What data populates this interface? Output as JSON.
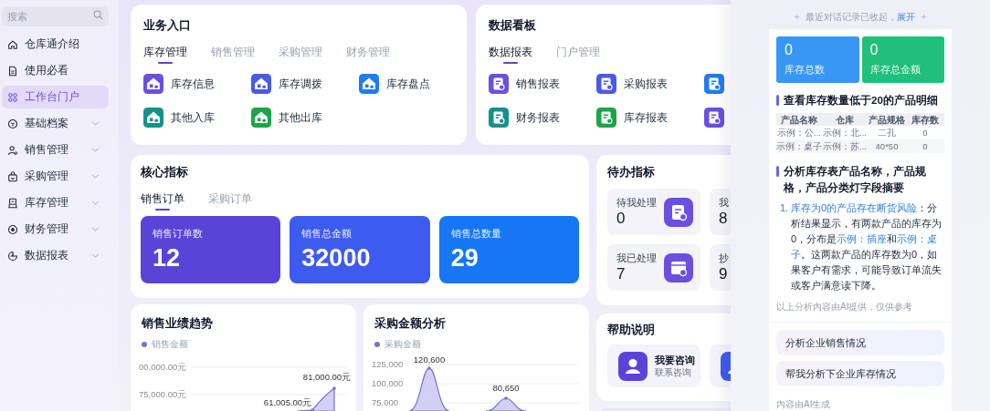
{
  "sidebar": {
    "search": {
      "placeholder": "搜索"
    },
    "items": [
      {
        "label": "仓库通介绍",
        "selected": false,
        "expandable": false
      },
      {
        "label": "使用必看",
        "selected": false,
        "expandable": false
      },
      {
        "label": "工作台门户",
        "selected": true,
        "expandable": false
      },
      {
        "label": "基础档案",
        "selected": false,
        "expandable": true
      },
      {
        "label": "销售管理",
        "selected": false,
        "expandable": true
      },
      {
        "label": "采购管理",
        "selected": false,
        "expandable": true
      },
      {
        "label": "库存管理",
        "selected": false,
        "expandable": true
      },
      {
        "label": "财务管理",
        "selected": false,
        "expandable": true
      },
      {
        "label": "数据报表",
        "selected": false,
        "expandable": true
      }
    ]
  },
  "entry_card": {
    "title": "业务入口",
    "tabs": [
      {
        "label": "库存管理",
        "selected": true
      },
      {
        "label": "销售管理",
        "selected": false
      },
      {
        "label": "采购管理",
        "selected": false
      },
      {
        "label": "财务管理",
        "selected": false
      }
    ],
    "items": [
      {
        "label": "库存信息",
        "color": "#6a4fe0"
      },
      {
        "label": "库存调拨",
        "color": "#4a5ae8"
      },
      {
        "label": "库存盘点",
        "color": "#1f7cf2"
      },
      {
        "label": "其他入库",
        "color": "#16918a"
      },
      {
        "label": "其他出库",
        "color": "#1ca548"
      }
    ]
  },
  "dashboard_card": {
    "title": "数据看板",
    "tabs": [
      {
        "label": "数据报表",
        "selected": true
      },
      {
        "label": "门户管理",
        "selected": false
      }
    ],
    "items": [
      {
        "label": "销售报表",
        "color": "#6a4fe0"
      },
      {
        "label": "采购报表",
        "color": "#4a5ae8"
      },
      {
        "color": "#1f7cf2"
      },
      {
        "label": "财务报表",
        "color": "#16918a"
      },
      {
        "label": "库存报表",
        "color": "#1ca548"
      },
      {
        "color": "#6a4fe0"
      }
    ]
  },
  "core_metrics": {
    "title": "核心指标",
    "tabs": [
      {
        "label": "销售订单",
        "selected": true
      },
      {
        "label": "采购订单",
        "selected": false
      }
    ],
    "stats": [
      {
        "label": "销售订单数",
        "value": "12",
        "color": "#5a44d8"
      },
      {
        "label": "销售总金额",
        "value": "32000",
        "color": "#3e5bf0"
      },
      {
        "label": "销售总数量",
        "value": "29",
        "color": "#1677f4"
      }
    ]
  },
  "todo": {
    "title": "待办指标",
    "items": [
      {
        "label": "待我处理",
        "value": "0",
        "icon": true
      },
      {
        "label": "我",
        "value": "8",
        "icon": false
      },
      {
        "label": "我已处理",
        "value": "7",
        "icon": true
      },
      {
        "label": "抄",
        "value": "9",
        "icon": false
      }
    ]
  },
  "help": {
    "title": "帮助说明",
    "items": [
      {
        "title": "我要咨询",
        "subtitle": "联系咨询",
        "color": "#5a44d8"
      },
      {
        "color": "#3e5bf0"
      }
    ]
  },
  "sales_trend": {
    "title": "销售业绩趋势",
    "legend": "销售金额",
    "axis_labels": [
      "00,000.00元",
      "75,000.00元"
    ],
    "point_labels": [
      "61,005.00元",
      "81,000.00元"
    ]
  },
  "purchase_analysis": {
    "title": "采购金额分析",
    "legend": "采购金额",
    "axis_labels": [
      "125,000",
      "100,000",
      "75,000"
    ],
    "point_labels": [
      "120,600",
      "80,650"
    ]
  },
  "ai_panel": {
    "collapsed_note": "最近对话记录已收起，",
    "expand_link": "展开",
    "stats": [
      {
        "value": "0",
        "label": "库存总数",
        "color": "#3897f5"
      },
      {
        "value": "0",
        "label": "库存总金额",
        "color": "#20bf7b"
      }
    ],
    "table_heading": "查看库存数量低于20的产品明细",
    "table": {
      "columns": [
        "产品名称",
        "仓库",
        "产品规格",
        "库存数"
      ],
      "rows": [
        [
          "示例：公...",
          "示例：北...",
          "二孔",
          "0"
        ],
        [
          "示例：桌子",
          "示例：苏...",
          "40*50",
          "0"
        ]
      ]
    },
    "summary_heading": "分析库存表产品名称，产品规格，产品分类灯字段摘要",
    "findings": [
      {
        "number": "1.",
        "text": "**库存为0的产品存在断货风险**：分析结果显示，有两款产品的库存为0，分布是**示例：插座**和**示例：桌子**。这两款产品的库存数为0，如果客户有需求，可能导致订单流失或客户满意读下降。"
      }
    ],
    "disclaimer": "以上分析内容由AI提供，仅供参考",
    "suggestions": [
      "分析企业销售情况",
      "帮我分析下企业库存情况"
    ],
    "footer": "内容由AI生成"
  }
}
